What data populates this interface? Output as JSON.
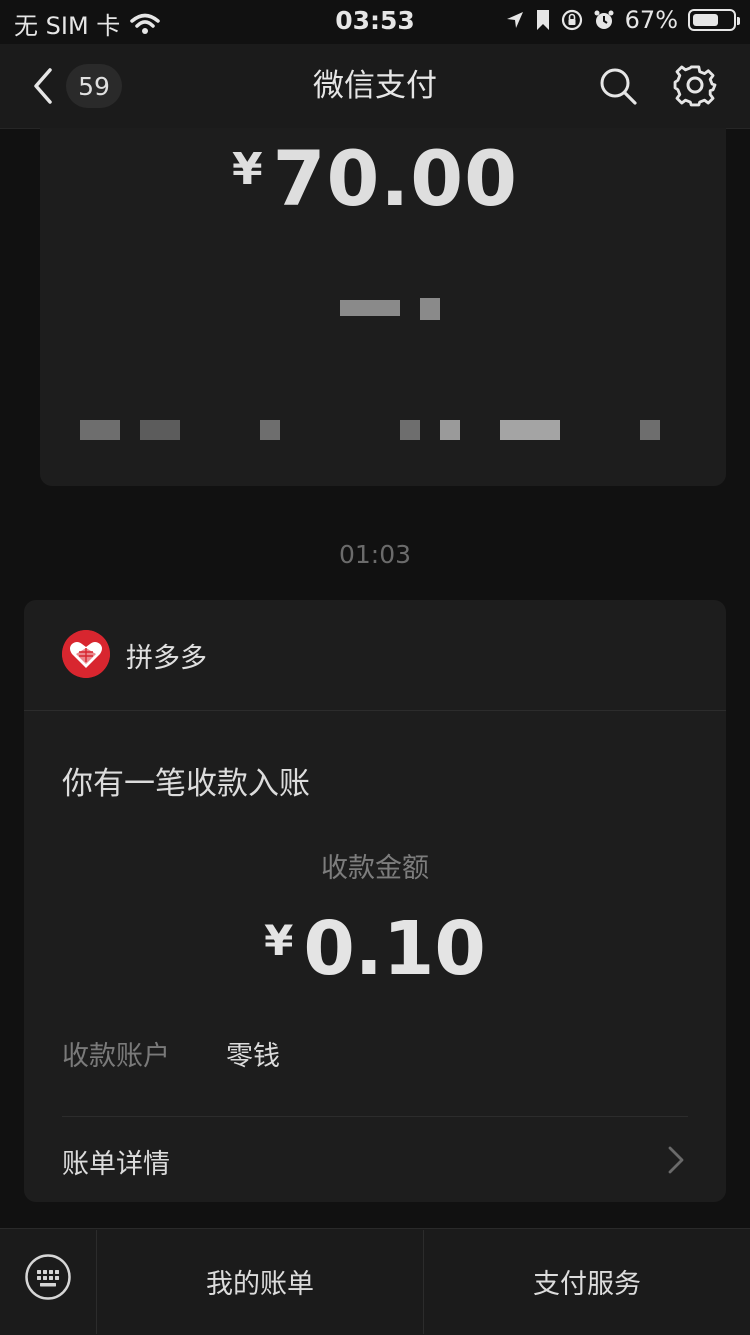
{
  "status_bar": {
    "carrier": "无 SIM 卡",
    "time": "03:53",
    "battery_percent": "67%",
    "battery_level": 0.67,
    "icons": [
      "wifi-icon",
      "location-arrow-icon",
      "bookmark-icon",
      "orientation-lock-icon",
      "alarm-icon",
      "battery-icon"
    ]
  },
  "nav": {
    "back_icon": "chevron-left-icon",
    "unread_count": "59",
    "title": "微信支付",
    "search_icon": "search-icon",
    "settings_icon": "gear-icon"
  },
  "previous_message": {
    "currency": "¥",
    "amount": "70.00"
  },
  "timestamp": "01:03",
  "message": {
    "merchant": "拼多多",
    "merchant_logo": "pinduoduo-logo",
    "headline": "你有一笔收款入账",
    "amount_label": "收款金额",
    "currency": "¥",
    "amount": "0.10",
    "account_label": "收款账户",
    "account_value": "零钱",
    "details_label": "账单详情"
  },
  "bottom_bar": {
    "keyboard_icon": "keyboard-icon",
    "tabs": [
      "我的账单",
      "支付服务"
    ]
  },
  "colors": {
    "background": "#111111",
    "card": "#1d1d1d",
    "nav": "#1b1b1b",
    "logo_red": "#d8262f"
  }
}
